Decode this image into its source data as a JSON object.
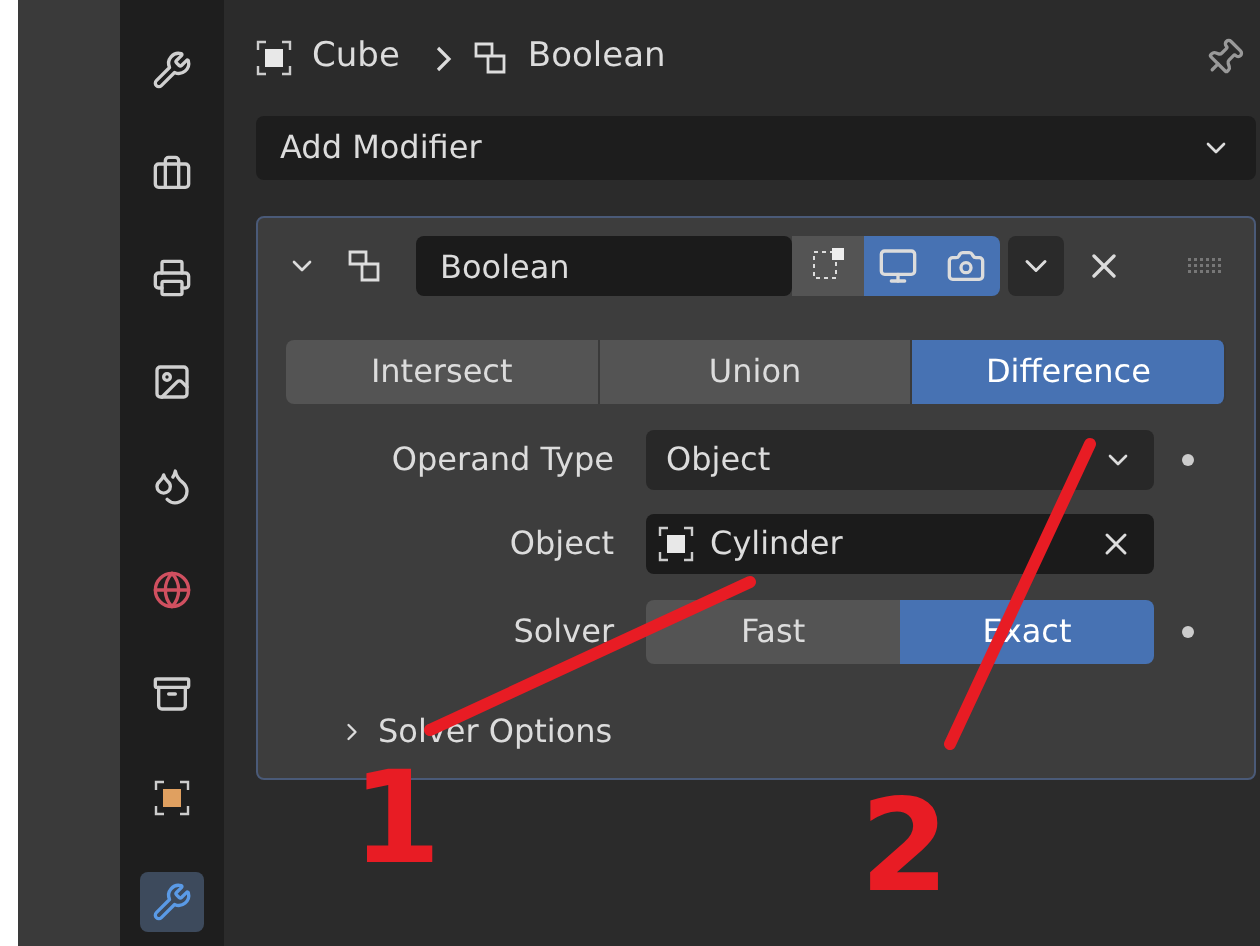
{
  "breadcrumb": {
    "object": "Cube",
    "modifier": "Boolean"
  },
  "sidebar": {
    "tabs": [
      {
        "selected": false
      },
      {
        "selected": false
      },
      {
        "selected": false
      },
      {
        "selected": false
      },
      {
        "selected": false
      },
      {
        "selected": false
      },
      {
        "selected": false
      },
      {
        "selected": false
      },
      {
        "selected": true
      }
    ]
  },
  "add_modifier": {
    "label": "Add Modifier"
  },
  "modifier": {
    "expanded": true,
    "name": "Boolean",
    "edit_mode": false,
    "viewport": true,
    "render": true,
    "operations": [
      {
        "label": "Intersect",
        "selected": false
      },
      {
        "label": "Union",
        "selected": false
      },
      {
        "label": "Difference",
        "selected": true
      }
    ],
    "operand_type": {
      "label": "Operand Type",
      "value": "Object"
    },
    "object": {
      "label": "Object",
      "value": "Cylinder"
    },
    "solver": {
      "label": "Solver",
      "options": [
        {
          "label": "Fast",
          "selected": false
        },
        {
          "label": "Exact",
          "selected": true
        }
      ]
    },
    "solver_options": {
      "label": "Solver Options",
      "expanded": false
    }
  },
  "annotations": [
    {
      "label": "1"
    },
    {
      "label": "2"
    }
  ]
}
